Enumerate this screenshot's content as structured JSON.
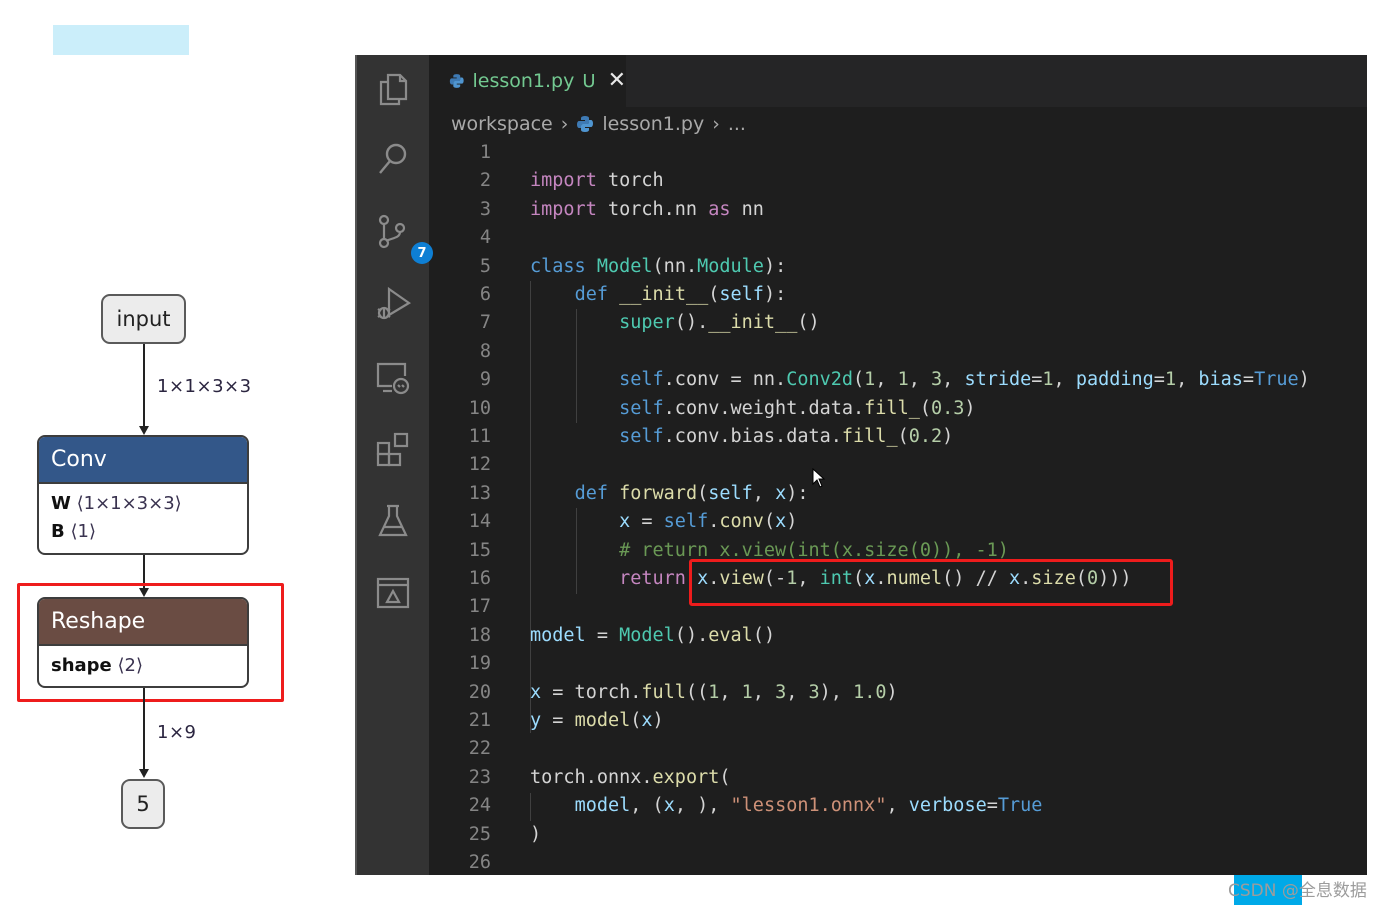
{
  "graph": {
    "input_node": "input",
    "edge1_label": "1×1×3×3",
    "conv": {
      "title": "Conv",
      "header_color": "#335789",
      "attrs": [
        {
          "name": "W",
          "dims": "⟨1×1×3×3⟩"
        },
        {
          "name": "B",
          "dims": "⟨1⟩"
        }
      ]
    },
    "reshape": {
      "title": "Reshape",
      "header_color": "#6a4c43",
      "attrs": [
        {
          "name": "shape",
          "dims": "⟨2⟩"
        }
      ]
    },
    "edge3_label": "1×9",
    "output_node": "5"
  },
  "editor": {
    "tab": {
      "filename": "lesson1.py",
      "status": "U",
      "close": "✕"
    },
    "breadcrumb": {
      "folder": "workspace",
      "file": "lesson1.py",
      "more": "..."
    },
    "activity_badge": "7",
    "lines": [
      {
        "n": "1"
      },
      {
        "n": "2"
      },
      {
        "n": "3"
      },
      {
        "n": "4"
      },
      {
        "n": "5"
      },
      {
        "n": "6"
      },
      {
        "n": "7"
      },
      {
        "n": "8"
      },
      {
        "n": "9"
      },
      {
        "n": "10"
      },
      {
        "n": "11"
      },
      {
        "n": "12"
      },
      {
        "n": "13"
      },
      {
        "n": "14"
      },
      {
        "n": "15"
      },
      {
        "n": "16"
      },
      {
        "n": "17"
      },
      {
        "n": "18"
      },
      {
        "n": "19"
      },
      {
        "n": "20"
      },
      {
        "n": "21"
      },
      {
        "n": "22"
      },
      {
        "n": "23"
      },
      {
        "n": "24"
      },
      {
        "n": "25"
      },
      {
        "n": "26"
      }
    ],
    "code": {
      "l2": [
        "import",
        " torch"
      ],
      "l3": [
        "import",
        " torch.nn ",
        "as",
        " nn"
      ],
      "l5": [
        "class",
        " ",
        "Model",
        "(nn.",
        "Module",
        "):"
      ],
      "l6": [
        "    ",
        "def",
        " ",
        "__init__",
        "(",
        "self",
        "):"
      ],
      "l7": [
        "        ",
        "super",
        "().",
        "__init__",
        "()"
      ],
      "l9": [
        "        ",
        "self",
        ".conv = nn.",
        "Conv2d",
        "(",
        "1",
        ", ",
        "1",
        ", ",
        "3",
        ", ",
        "stride",
        "=",
        "1",
        ", ",
        "padding",
        "=",
        "1",
        ", ",
        "bias",
        "=",
        "True",
        ")"
      ],
      "l10": [
        "        ",
        "self",
        ".conv.weight.data.",
        "fill_",
        "(",
        "0.3",
        ")"
      ],
      "l11": [
        "        ",
        "self",
        ".conv.bias.data.",
        "fill_",
        "(",
        "0.2",
        ")"
      ],
      "l13": [
        "    ",
        "def",
        " ",
        "forward",
        "(",
        "self",
        ", ",
        "x",
        "):"
      ],
      "l14": [
        "        ",
        "x",
        " = ",
        "self",
        ".",
        "conv",
        "(",
        "x",
        ")"
      ],
      "l15": [
        "        ",
        "# return x.view(int(x.size(0)), -1)"
      ],
      "l16": [
        "        ",
        "return",
        " ",
        "x",
        ".",
        "view",
        "(-",
        "1",
        ", ",
        "int",
        "(",
        "x",
        ".",
        "numel",
        "() // ",
        "x",
        ".",
        "size",
        "(",
        "0",
        ")))"
      ],
      "l18": [
        "model",
        " = ",
        "Model",
        "().",
        "eval",
        "()"
      ],
      "l20": [
        "x",
        " = torch.",
        "full",
        "((",
        "1",
        ", ",
        "1",
        ", ",
        "3",
        ", ",
        "3",
        "), ",
        "1.0",
        ")"
      ],
      "l21": [
        "y",
        " = ",
        "model",
        "(",
        "x",
        ")"
      ],
      "l23": [
        "torch.onnx.",
        "export",
        "("
      ],
      "l24": [
        "    ",
        "model",
        ", (",
        "x",
        ", ), ",
        "\"lesson1.onnx\"",
        ", ",
        "verbose",
        "=",
        "True"
      ],
      "l25": [
        ")"
      ]
    }
  },
  "watermark": "CSDN @全息数据"
}
